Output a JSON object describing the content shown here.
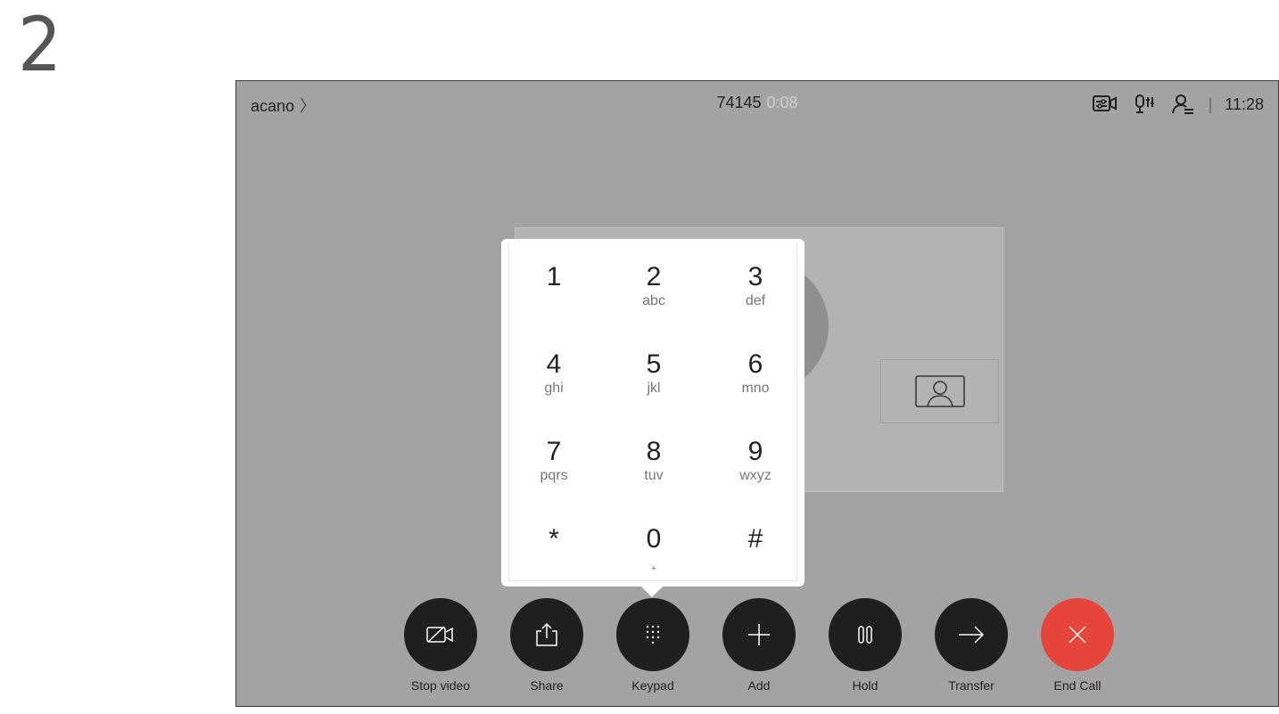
{
  "step_number": "2",
  "topbar": {
    "meeting_name": "acano",
    "meeting_chevron": "〉",
    "call_number": "74145",
    "call_duration": "0:08",
    "separator": "|",
    "clock": "11:28",
    "icons": [
      "camera-settings-icon",
      "microphone-settings-icon",
      "participants-icon"
    ]
  },
  "keypad": {
    "keys": [
      {
        "digit": "1",
        "letters": ""
      },
      {
        "digit": "2",
        "letters": "abc"
      },
      {
        "digit": "3",
        "letters": "def"
      },
      {
        "digit": "4",
        "letters": "ghi"
      },
      {
        "digit": "5",
        "letters": "jkl"
      },
      {
        "digit": "6",
        "letters": "mno"
      },
      {
        "digit": "7",
        "letters": "pqrs"
      },
      {
        "digit": "8",
        "letters": "tuv"
      },
      {
        "digit": "9",
        "letters": "wxyz"
      },
      {
        "digit": "*",
        "letters": ""
      },
      {
        "digit": "0",
        "letters": "+"
      },
      {
        "digit": "#",
        "letters": ""
      }
    ]
  },
  "controls": {
    "stop_video": "Stop video",
    "share": "Share",
    "keypad": "Keypad",
    "add": "Add",
    "hold": "Hold",
    "transfer": "Transfer",
    "end_call": "End Call"
  },
  "colors": {
    "screen_bg": "#a3a3a3",
    "control_button": "#1f1f1f",
    "end_call_button": "#e5453b"
  }
}
